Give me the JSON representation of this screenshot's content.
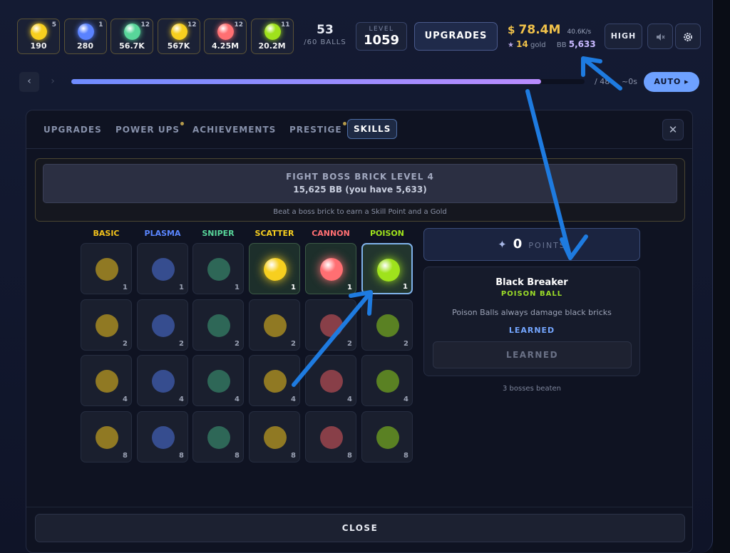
{
  "top_bar": {
    "ball_chips": [
      {
        "type": "basic",
        "level": "5",
        "amount": "190",
        "color": "#f7cf1f"
      },
      {
        "type": "plasma",
        "level": "1",
        "amount": "280",
        "color": "#5a82ff"
      },
      {
        "type": "sniper",
        "level": "12",
        "amount": "56.7K",
        "color": "#58d69a"
      },
      {
        "type": "scatter",
        "level": "12",
        "amount": "567K",
        "color": "#f7cf1f"
      },
      {
        "type": "cannon",
        "level": "12",
        "amount": "4.25M",
        "color": "#ff6f72"
      },
      {
        "type": "poison",
        "level": "11",
        "amount": "20.2M",
        "color": "#9fe21c"
      }
    ],
    "balls_count": "53",
    "balls_max": "/60 BALLS",
    "level_label": "LEVEL",
    "level_value": "1059",
    "upgrades_label": "UPGRADES",
    "money_symbol": "$",
    "money": "78.4M",
    "money_rate": "40.6K/s",
    "gold_count": "14",
    "gold_label": "gold",
    "bb_label": "BB",
    "bb_count": "5,633",
    "quality_label": "HIGH",
    "sound_icon": "speaker-muted-icon",
    "settings_icon": "gear-icon"
  },
  "progress": {
    "fraction": 0.915,
    "wave_text": "/ 48",
    "eta_text": "~0s",
    "auto_label": "AUTO ▸"
  },
  "modal": {
    "tabs": [
      {
        "label": "UPGRADES",
        "dot": false
      },
      {
        "label": "POWER UPS",
        "dot": true
      },
      {
        "label": "ACHIEVEMENTS",
        "dot": false
      },
      {
        "label": "PRESTIGE",
        "dot": true
      },
      {
        "label": "SKILLS",
        "dot": false,
        "active": true
      }
    ],
    "boss": {
      "title": "FIGHT BOSS BRICK LEVEL 4",
      "cost": "15,625 BB (you have 5,633)",
      "hint": "Beat a boss brick to earn a Skill Point and a Gold"
    },
    "skill_columns": [
      {
        "name": "BASIC",
        "color": "#f2c21b",
        "head_color": "#f2c21b"
      },
      {
        "name": "PLASMA",
        "color": "#4f72e0",
        "head_color": "#5a86ff"
      },
      {
        "name": "SNIPER",
        "color": "#3fa37a",
        "head_color": "#58d69a"
      },
      {
        "name": "SCATTER",
        "color": "#f2c21b",
        "head_color": "#f7cf1f"
      },
      {
        "name": "CANNON",
        "color": "#e45a5e",
        "head_color": "#ff6f72"
      },
      {
        "name": "POISON",
        "color": "#8fd21c",
        "head_color": "#9fe21c"
      }
    ],
    "skill_rows": [
      "1",
      "2",
      "4",
      "8"
    ],
    "learned_cells": [
      "3-0",
      "4-0",
      "5-0"
    ],
    "selected_cell": "5-0",
    "points": {
      "value": "0",
      "label": "POINTS"
    },
    "detail": {
      "name": "Black Breaker",
      "ball_type": "POISON BALL",
      "description": "Poison Balls always damage black bricks",
      "status": "LEARNED",
      "button_label": "LEARNED"
    },
    "bosses_beaten": "3 bosses beaten",
    "close_label": "CLOSE"
  },
  "annotation_color": "#1e7be0"
}
